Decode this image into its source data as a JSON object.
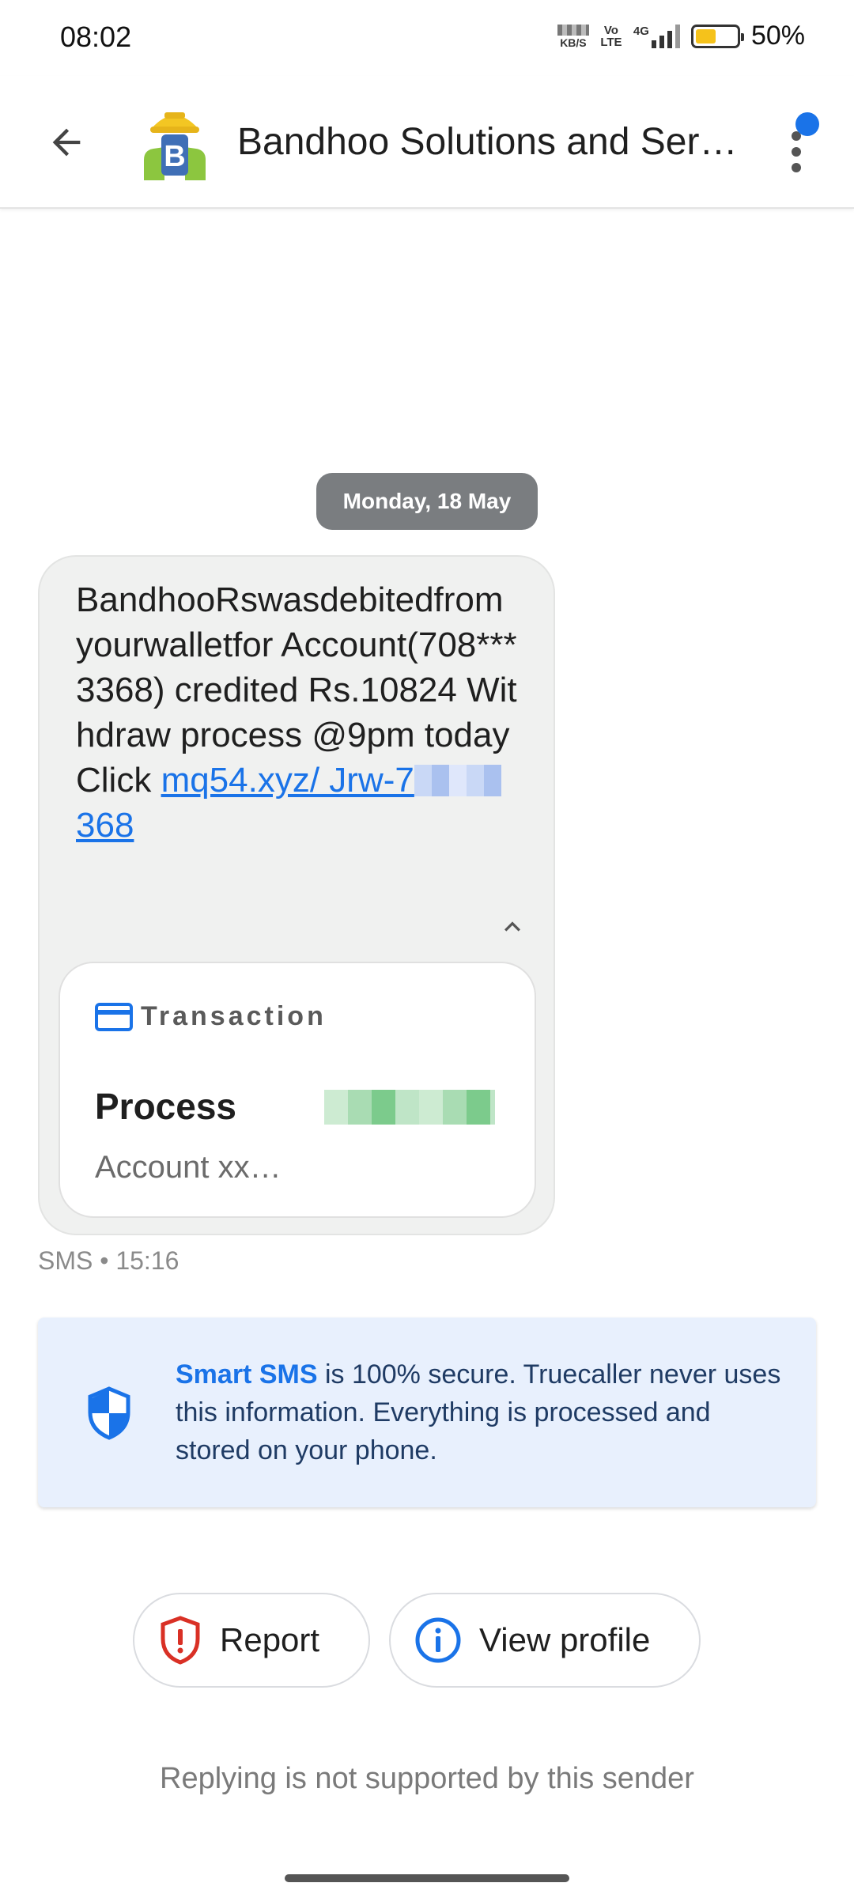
{
  "status_bar": {
    "time": "08:02",
    "net_speed_unit": "KB/S",
    "volte": "Vo LTE",
    "network": "4G",
    "battery_level": 0.5,
    "battery": "50%"
  },
  "app_bar": {
    "sender_name": "Bandhoo Solutions and Ser…",
    "avatar_letter": "B"
  },
  "conversation": {
    "date_chip": "Monday, 18 May",
    "message": {
      "text": "BandhooRswasdebitedfromyourwalletfor Account(708***3368) credited Rs.10824 Withdraw process @9pm today Click ",
      "link_prefix": "mq54.xyz/ Jrw-7",
      "link_suffix": "368",
      "meta": "SMS • 15:16"
    },
    "transaction_card": {
      "title": "Transaction",
      "label": "Process",
      "sub": "Account xx…"
    }
  },
  "info_card": {
    "highlight": "Smart SMS",
    "text": " is 100% secure. Truecaller never uses this information. Everything is processed and stored on your phone."
  },
  "actions": {
    "report_label": "Report",
    "view_profile_label": "View profile"
  },
  "footer": {
    "note": "Replying is not supported by this sender"
  },
  "colors": {
    "accent": "#1a73e8",
    "report_red": "#d93025",
    "bubble_bg": "#f0f1f0",
    "info_bg": "#e8f0fd"
  }
}
